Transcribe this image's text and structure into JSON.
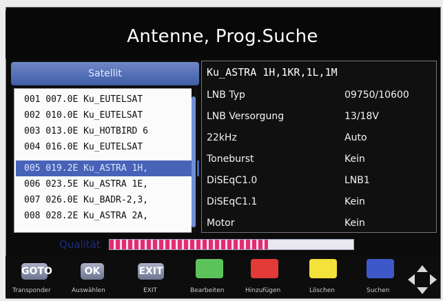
{
  "screen": {
    "title": "Antenne, Prog.Suche"
  },
  "satellite_list": {
    "header": "Satellit",
    "items": [
      "001 007.0E Ku_EUTELSAT",
      "002 010.0E Ku_EUTELSAT",
      "003 013.0E Ku_HOTBIRD 6",
      "004 016.0E Ku_EUTELSAT",
      "005 019.2E Ku_ASTRA 1H,",
      "006 023.5E Ku_ASTRA 1E,",
      "007 026.0E Ku_BADR-2,3,",
      "008 028.2E Ku_ASTRA 2A,"
    ],
    "selected_index": 4
  },
  "details": {
    "title": "Ku_ASTRA 1H,1KR,1L,1M",
    "rows": [
      {
        "label": "LNB Typ",
        "value": "09750/10600"
      },
      {
        "label": "LNB Versorgung",
        "value": "13/18V"
      },
      {
        "label": "22kHz",
        "value": "Auto"
      },
      {
        "label": "Toneburst",
        "value": "Kein"
      },
      {
        "label": "DiSEqC1.0",
        "value": "LNB1"
      },
      {
        "label": "DiSEqC1.1",
        "value": "Kein"
      },
      {
        "label": "Motor",
        "value": "Kein"
      }
    ]
  },
  "quality": {
    "label": "Qualität",
    "level": 0.65
  },
  "keys": {
    "goto": {
      "label": "GOTO",
      "caption": "Transponder"
    },
    "ok": {
      "label": "OK",
      "caption": "Auswählen"
    },
    "exit": {
      "label": "EXIT",
      "caption": "EXIT"
    },
    "green": {
      "caption": "Bearbeiten",
      "color": "#5cc35a"
    },
    "red": {
      "caption": "Hinzufügen",
      "color": "#e23a36"
    },
    "yellow": {
      "caption": "Löschen",
      "color": "#f2e23a"
    },
    "blue": {
      "caption": "Suchen",
      "color": "#3f58c9"
    }
  },
  "icons": {
    "navigation": "dpad-arrows-icon"
  }
}
